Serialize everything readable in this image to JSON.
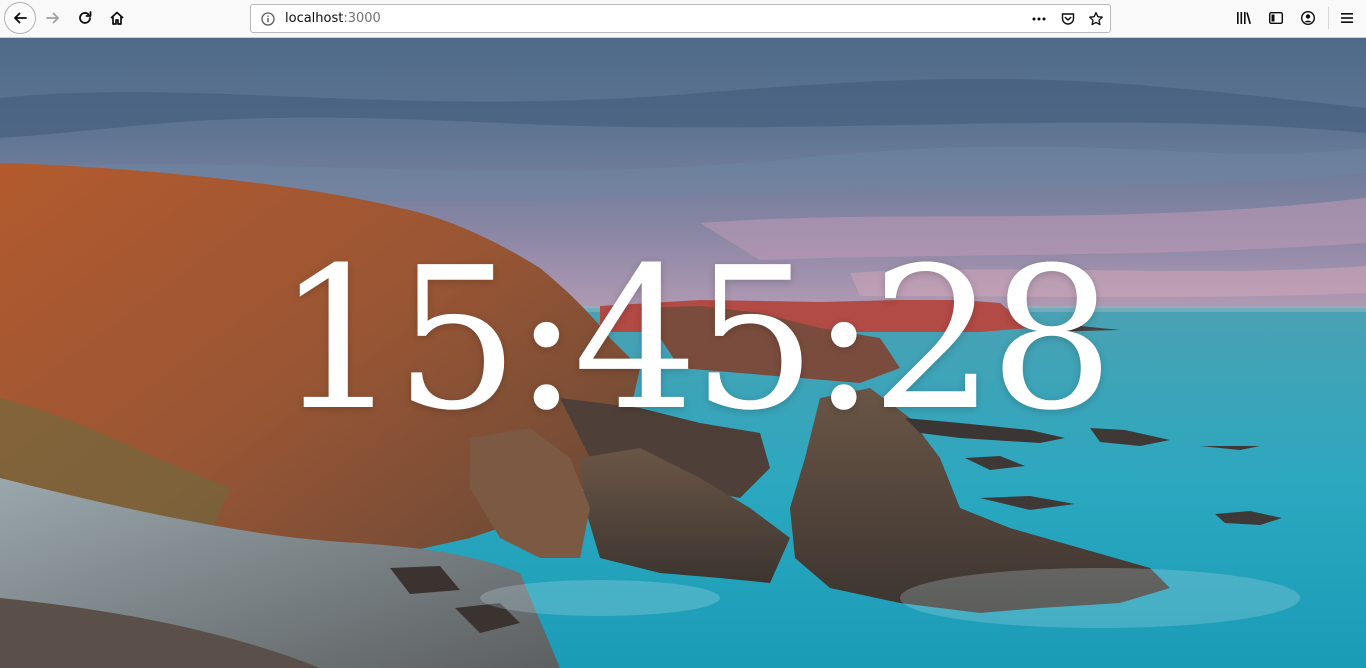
{
  "browser": {
    "url": {
      "host": "localhost",
      "port": ":3000"
    },
    "icons": {
      "back": "back-arrow-icon",
      "forward": "forward-arrow-icon",
      "reload": "reload-icon",
      "home": "home-icon",
      "info": "info-icon",
      "page_actions": "more-dots-icon",
      "pocket": "pocket-icon",
      "bookmark": "star-icon",
      "library": "library-icon",
      "sidebar": "sidebar-icon",
      "account": "account-icon",
      "menu": "hamburger-menu-icon"
    }
  },
  "clock": {
    "time": "15:45:28"
  },
  "background": {
    "description_colors": {
      "sky": "#5d7896",
      "cliff": "#a4532c",
      "sea": "#2aa6bd"
    }
  }
}
